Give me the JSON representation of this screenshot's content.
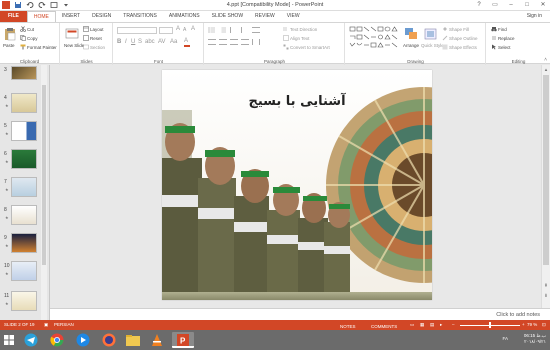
{
  "window": {
    "title": "4.ppt [Compatibility Mode] - PowerPoint",
    "help": "?",
    "signin": "Sign in"
  },
  "tabs": [
    "FILE",
    "HOME",
    "INSERT",
    "DESIGN",
    "TRANSITIONS",
    "ANIMATIONS",
    "SLIDE SHOW",
    "REVIEW",
    "VIEW"
  ],
  "ribbon": {
    "clipboard": {
      "label": "Clipboard",
      "paste": "Paste",
      "cut": "Cut",
      "copy": "Copy",
      "format_painter": "Format Painter"
    },
    "slides": {
      "label": "Slides",
      "new_slide": "New Slide",
      "layout": "Layout",
      "reset": "Reset",
      "section": "Section"
    },
    "font": {
      "label": "Font"
    },
    "paragraph": {
      "label": "Paragraph",
      "text_direction": "Text Direction",
      "align_text": "Align Text",
      "smartart": "Convert to SmartArt"
    },
    "drawing": {
      "label": "Drawing",
      "arrange": "Arrange",
      "quick_styles": "Quick Styles",
      "shape_fill": "Shape Fill",
      "shape_outline": "Shape Outline",
      "shape_effects": "Shape Effects"
    },
    "editing": {
      "label": "Editing",
      "find": "Find",
      "replace": "Replace",
      "select": "Select"
    }
  },
  "thumbnails": [
    {
      "num": "3"
    },
    {
      "num": "4"
    },
    {
      "num": "5"
    },
    {
      "num": "6"
    },
    {
      "num": "7"
    },
    {
      "num": "8"
    },
    {
      "num": "9"
    },
    {
      "num": "10"
    },
    {
      "num": "11"
    }
  ],
  "slide": {
    "title": "آشنایی با بسیج"
  },
  "notes": {
    "placeholder": "Click to add notes"
  },
  "status": {
    "slide_counter": "SLIDE 2 OF 19",
    "language": "PERSIAN",
    "notes": "NOTES",
    "comments": "COMMENTS",
    "zoom": "79 %"
  },
  "taskbar": {
    "lang": "FA",
    "time": "06:15 ب.ظ",
    "date": "۲۰۱۸/۰۹/۲۱"
  },
  "colors": {
    "accent": "#d24726",
    "taskbar": "#6b6b6b"
  }
}
